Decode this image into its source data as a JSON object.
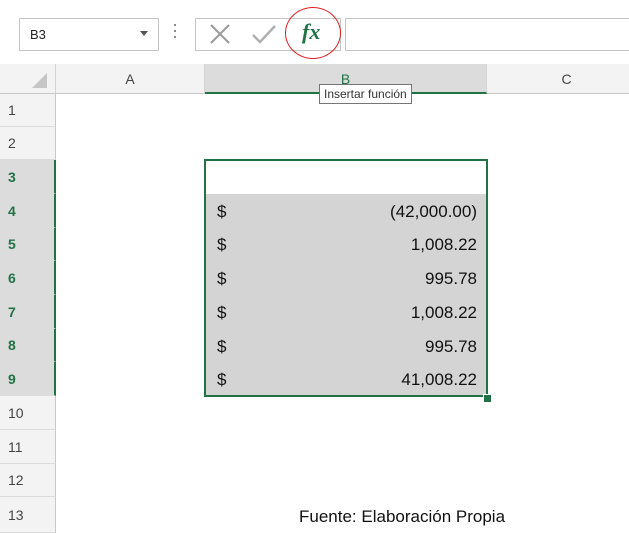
{
  "formula_bar": {
    "name_box": "B3",
    "fx_label": "fx",
    "tooltip": "Insertar función"
  },
  "columns": [
    "A",
    "B",
    "C"
  ],
  "rows": [
    "1",
    "2",
    "3",
    "4",
    "5",
    "6",
    "7",
    "8",
    "9",
    "10",
    "11",
    "12",
    "13"
  ],
  "cells": {
    "b4": {
      "currency": "$",
      "amount": "(42,000.00)"
    },
    "b5": {
      "currency": "$",
      "amount": "1,008.22"
    },
    "b6": {
      "currency": "$",
      "amount": "995.78"
    },
    "b7": {
      "currency": "$",
      "amount": "1,008.22"
    },
    "b8": {
      "currency": "$",
      "amount": "995.78"
    },
    "b9": {
      "currency": "$",
      "amount": "41,008.22"
    }
  },
  "caption": "Fuente: Elaboración Propia",
  "colors": {
    "accent": "#217346",
    "highlight_circle": "#e02020",
    "selection_fill": "#d4d4d4"
  }
}
